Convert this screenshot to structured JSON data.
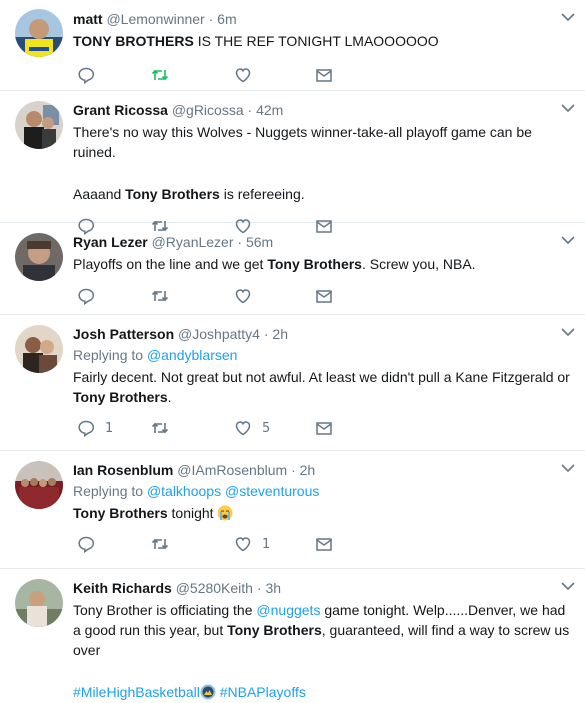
{
  "tweets": [
    {
      "name": "matt",
      "handle": "@Lemonwinner",
      "sep": "·",
      "time": "6m",
      "t1": "TONY BROTHERS",
      "t2": " IS THE REF TONIGHT LMAOOOOOO",
      "retweeted": true
    },
    {
      "name": "Grant Ricossa",
      "handle": "@gRicossa",
      "sep": "·",
      "time": "42m",
      "line1": "There's no way this Wolves - Nuggets winner-take-all playoff game can be ruined.",
      "t1": "Aaaand ",
      "t2": "Tony Brothers",
      "t3": " is refereeing."
    },
    {
      "name": "Ryan Lezer",
      "handle": "@RyanLezer",
      "sep": "·",
      "time": "56m",
      "t1": "Playoffs on the line and we get ",
      "t2": "Tony Brothers",
      "t3": ". Screw you, NBA."
    },
    {
      "name": "Josh Patterson",
      "handle": "@Joshpatty4",
      "sep": "·",
      "time": "2h",
      "replying_label": "Replying to ",
      "reply_to": "@andyblarsen",
      "t1": "Fairly decent. Not great but not awful. At least we didn't pull a Kane Fitzgerald or ",
      "t2": "Tony Brothers",
      "t3": ".",
      "reply_count": "1",
      "like_count": "5"
    },
    {
      "name": "Ian Rosenblum",
      "handle": "@IAmRosenblum",
      "sep": "·",
      "time": "2h",
      "replying_label": "Replying to ",
      "reply_to_1": "@talkhoops",
      "reply_to_2": "@steventurous",
      "t1": "Tony Brothers",
      "t2": " tonight ",
      "like_count": "1",
      "emoji": "crying-face-icon"
    },
    {
      "name": "Keith Richards",
      "handle": "@5280Keith",
      "sep": "·",
      "time": "3h",
      "t1": "Tony Brother is officiating the ",
      "t2": "@nuggets",
      "t3": " game tonight.  Welp......Denver, we had a good run this year, but ",
      "t4": "Tony Brothers",
      "t5": ", guaranteed, will find a way to screw us over",
      "hashtag1": "#MileHighBasketball",
      "hashtag2": "#NBAPlayoffs",
      "emoji": "nuggets-logo-icon"
    }
  ],
  "colors": {
    "link": "#1da1f2",
    "muted": "#657786",
    "retweet_active": "#17bf63",
    "divider": "#e6ecf0"
  }
}
